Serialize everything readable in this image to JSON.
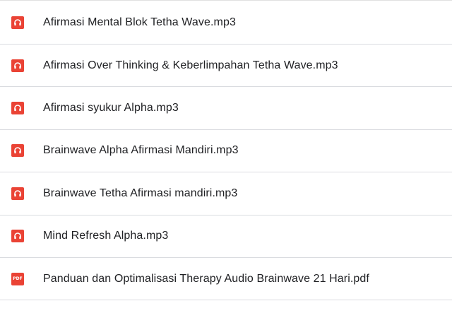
{
  "colors": {
    "audio_icon": "#ea4335",
    "pdf_icon": "#ea4335",
    "divider": "#dadce0",
    "text": "#202124"
  },
  "files": [
    {
      "name": "Afirmasi Mental Blok Tetha Wave.mp3",
      "icon": "headphones-icon",
      "type": "audio"
    },
    {
      "name": "Afirmasi Over Thinking & Keberlimpahan Tetha Wave.mp3",
      "icon": "headphones-icon",
      "type": "audio"
    },
    {
      "name": "Afirmasi syukur Alpha.mp3",
      "icon": "headphones-icon",
      "type": "audio"
    },
    {
      "name": "Brainwave Alpha Afirmasi Mandiri.mp3",
      "icon": "headphones-icon",
      "type": "audio"
    },
    {
      "name": "Brainwave Tetha Afirmasi mandiri.mp3",
      "icon": "headphones-icon",
      "type": "audio"
    },
    {
      "name": "Mind Refresh Alpha.mp3",
      "icon": "headphones-icon",
      "type": "audio"
    },
    {
      "name": "Panduan dan Optimalisasi Therapy Audio Brainwave 21 Hari.pdf",
      "icon": "pdf-icon",
      "type": "pdf",
      "icon_text": "PDF"
    }
  ]
}
